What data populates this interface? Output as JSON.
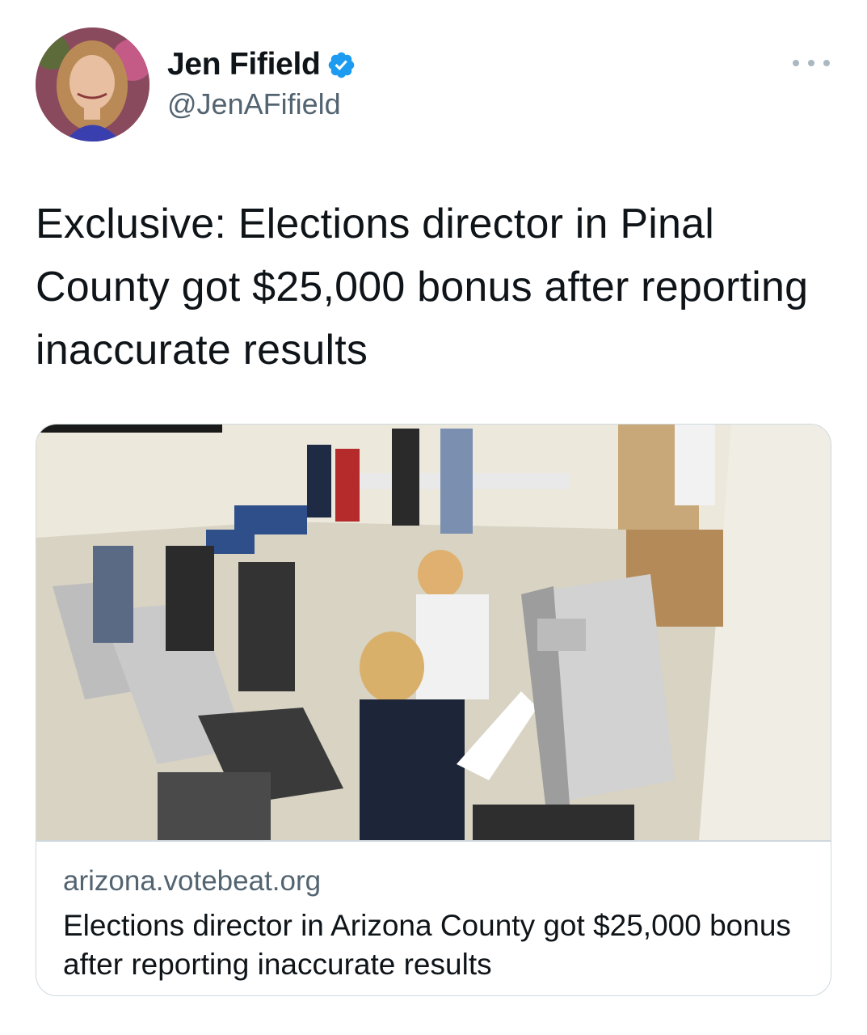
{
  "tweet": {
    "author": {
      "display_name": "Jen Fifield",
      "handle": "@JenAFifield",
      "verified": true
    },
    "text": "Exclusive: Elections director in Pinal County got $25,000 bonus after reporting inaccurate results",
    "card": {
      "domain": "arizona.votebeat.org",
      "title": "Elections director in Arizona County got $25,000 bonus after reporting inaccurate results"
    }
  },
  "icons": {
    "verified": "verified-badge-icon",
    "more": "more-options-icon"
  },
  "colors": {
    "verified_blue": "#1d9bf0",
    "handle_gray": "#536471",
    "border": "#cfd9de"
  }
}
